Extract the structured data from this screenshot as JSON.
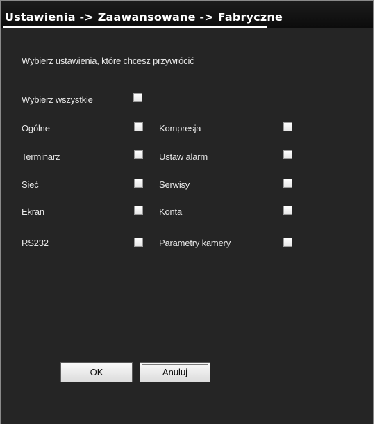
{
  "title": "Ustawienia -> Zaawansowane -> Fabryczne",
  "instruction": "Wybierz ustawienia, które chcesz przywrócić",
  "select_all": {
    "label": "Wybierz wszystkie",
    "checked": false
  },
  "left_column": [
    {
      "label": "Ogólne",
      "checked": false
    },
    {
      "label": "Terminarz",
      "checked": false
    },
    {
      "label": "Sieć",
      "checked": false
    },
    {
      "label": "Ekran",
      "checked": false
    },
    {
      "label": "RS232",
      "checked": false
    }
  ],
  "right_column": [
    {
      "label": "Kompresja",
      "checked": false
    },
    {
      "label": "Ustaw alarm",
      "checked": false
    },
    {
      "label": "Serwisy",
      "checked": false
    },
    {
      "label": "Konta",
      "checked": false
    },
    {
      "label": "Parametry kamery",
      "checked": false
    }
  ],
  "buttons": {
    "ok": "OK",
    "cancel": "Anuluj"
  }
}
